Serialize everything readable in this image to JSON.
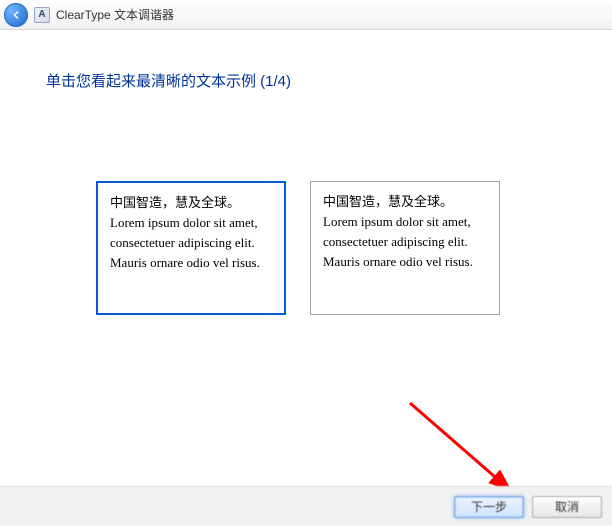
{
  "titlebar": {
    "title": "ClearType 文本调谐器",
    "app_icon_letter": "A"
  },
  "heading": "单击您看起来最清晰的文本示例 (1/4)",
  "samples": [
    {
      "line1": "中国智造，慧及全球。",
      "line2": "Lorem ipsum dolor sit amet, consectetuer adipiscing elit. Mauris ornare odio vel risus.",
      "selected": true
    },
    {
      "line1": "中国智造，慧及全球。",
      "line2": "Lorem ipsum dolor sit amet, consectetuer adipiscing elit. Mauris ornare odio vel risus.",
      "selected": false
    }
  ],
  "footer": {
    "next_label": "下一步",
    "cancel_label": "取消"
  },
  "colors": {
    "accent": "#0a5bd3",
    "heading": "#003399",
    "annotation": "#ff0000"
  }
}
